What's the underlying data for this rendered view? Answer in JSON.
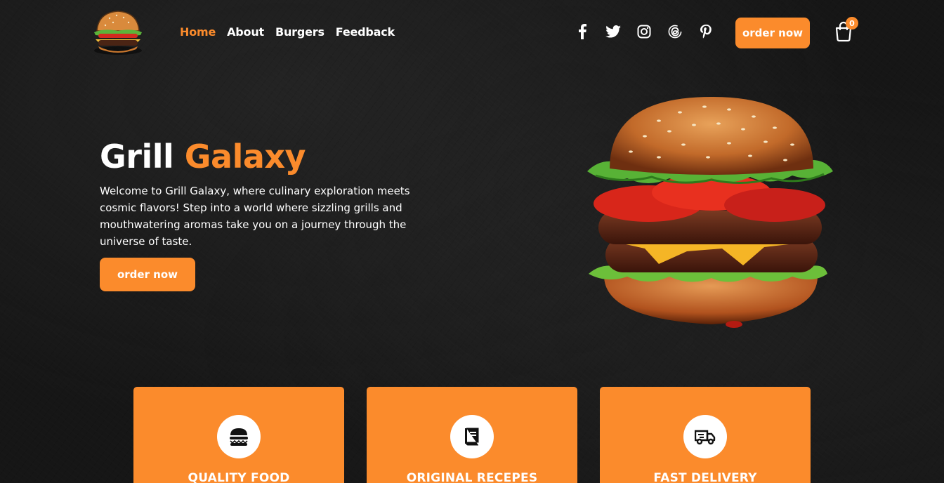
{
  "brand": {
    "logo_icon": "burger-logo-icon"
  },
  "nav": {
    "items": [
      {
        "label": "Home",
        "active": true
      },
      {
        "label": "About"
      },
      {
        "label": "Burgers"
      },
      {
        "label": "Feedback"
      }
    ]
  },
  "socials": [
    "facebook-icon",
    "twitter-icon",
    "instagram-icon",
    "threads-icon",
    "pinterest-icon"
  ],
  "header": {
    "order_label": "order now",
    "cart_count": "0"
  },
  "hero": {
    "title_main": "Grill ",
    "title_accent": "Galaxy",
    "text": "Welcome to Grill Galaxy, where culinary exploration meets cosmic flavors! Step into a world where sizzling grills and mouthwatering aromas take you on a journey through the universe of taste.",
    "order_label": "order now"
  },
  "features": [
    {
      "title": "QUALITY FOOD",
      "icon": "burger-icon"
    },
    {
      "title": "ORIGINAL RECEPES",
      "icon": "book-icon"
    },
    {
      "title": "FAST DELIVERY",
      "icon": "truck-icon"
    }
  ],
  "colors": {
    "accent": "#fb8b2c",
    "background": "#161616"
  }
}
